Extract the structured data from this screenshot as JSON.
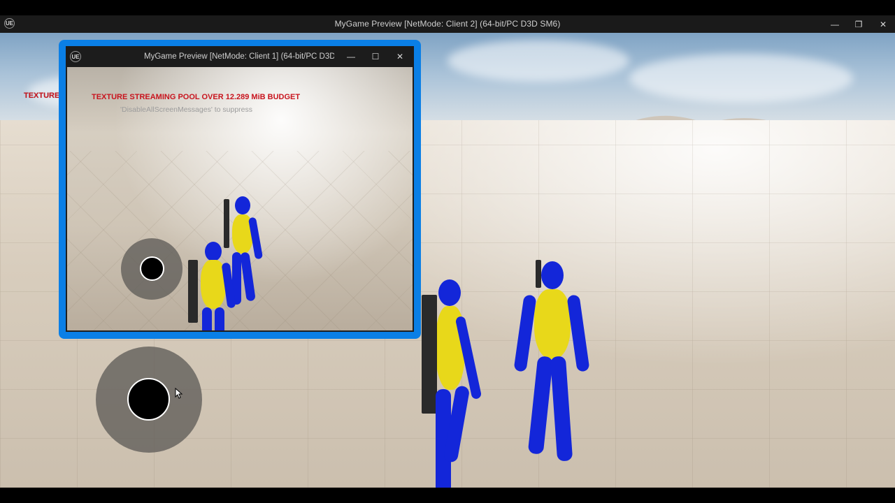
{
  "main_window": {
    "title": "MyGame Preview [NetMode: Client 2]  (64-bit/PC D3D SM6)",
    "logo": "UE",
    "controls": {
      "minimize": "—",
      "restore": "❐",
      "close": "✕"
    },
    "warning_text": "TEXTURE"
  },
  "inset_window": {
    "title": "MyGame Preview [NetMode: Client 1]  (64-bit/PC D3D",
    "logo": "UE",
    "controls": {
      "minimize": "—",
      "maximize": "☐",
      "close": "✕"
    },
    "warning_text": "TEXTURE STREAMING POOL OVER 12.289 MiB BUDGET",
    "hint_text": "'DisableAllScreenMessages' to suppress"
  },
  "colors": {
    "accent_frame": "#0a7fe6",
    "warning": "#c8141e",
    "character_body": "#1326d9",
    "character_suit": "#e8d81a"
  }
}
